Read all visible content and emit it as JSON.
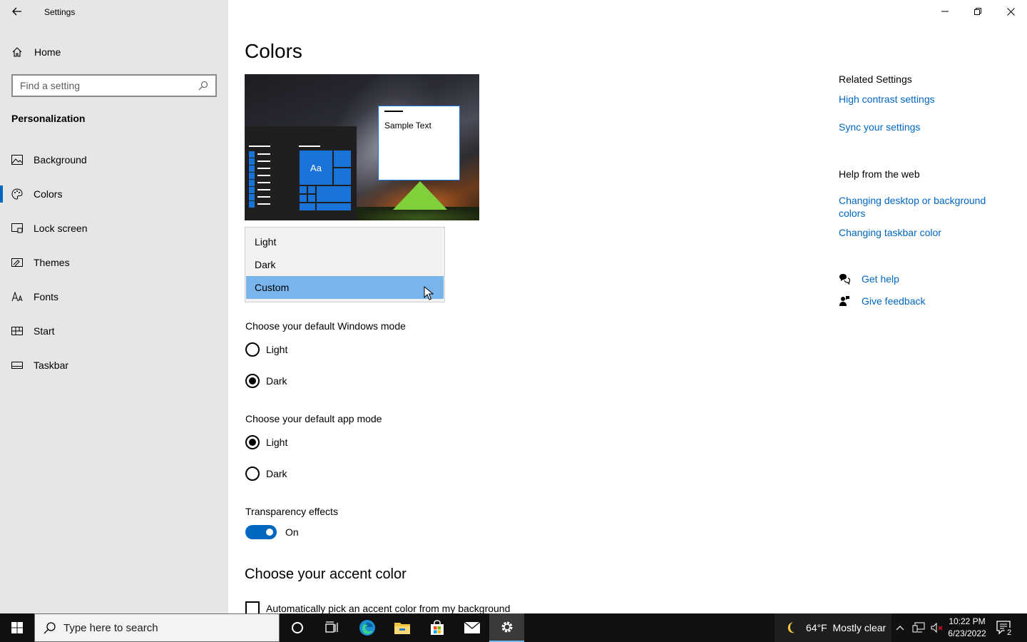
{
  "app": {
    "title": "Settings"
  },
  "sidebar": {
    "home_label": "Home",
    "search_placeholder": "Find a setting",
    "section_title": "Personalization",
    "items": [
      {
        "label": "Background",
        "icon": "image-icon"
      },
      {
        "label": "Colors",
        "icon": "palette-icon",
        "active": true
      },
      {
        "label": "Lock screen",
        "icon": "lock-screen-icon"
      },
      {
        "label": "Themes",
        "icon": "themes-icon"
      },
      {
        "label": "Fonts",
        "icon": "fonts-icon"
      },
      {
        "label": "Start",
        "icon": "start-icon"
      },
      {
        "label": "Taskbar",
        "icon": "taskbar-icon"
      }
    ]
  },
  "main": {
    "title": "Colors",
    "preview": {
      "tile_label": "Aa",
      "sample_text": "Sample Text"
    },
    "color_dropdown": {
      "options": [
        "Light",
        "Dark",
        "Custom"
      ],
      "highlighted": "Custom"
    },
    "windows_mode": {
      "label": "Choose your default Windows mode",
      "options": [
        "Light",
        "Dark"
      ],
      "selected": "Dark"
    },
    "app_mode": {
      "label": "Choose your default app mode",
      "options": [
        "Light",
        "Dark"
      ],
      "selected": "Light"
    },
    "transparency": {
      "label": "Transparency effects",
      "state": "On"
    },
    "accent_heading": "Choose your accent color",
    "auto_accent_label": "Automatically pick an accent color from my background"
  },
  "related": {
    "heading": "Related Settings",
    "links": [
      "High contrast settings",
      "Sync your settings"
    ],
    "web_heading": "Help from the web",
    "web_links": [
      "Changing desktop or background colors",
      "Changing taskbar color"
    ],
    "get_help": "Get help",
    "give_feedback": "Give feedback"
  },
  "taskbar": {
    "search_placeholder": "Type here to search",
    "weather": "64°F  Mostly clear",
    "time": "10:22 PM",
    "date": "6/23/2022",
    "notification_count": "2"
  },
  "colors": {
    "accent": "#0067c0",
    "sidebar_bg": "#e6e6e6",
    "dropdown_highlight": "#78b5ec"
  }
}
